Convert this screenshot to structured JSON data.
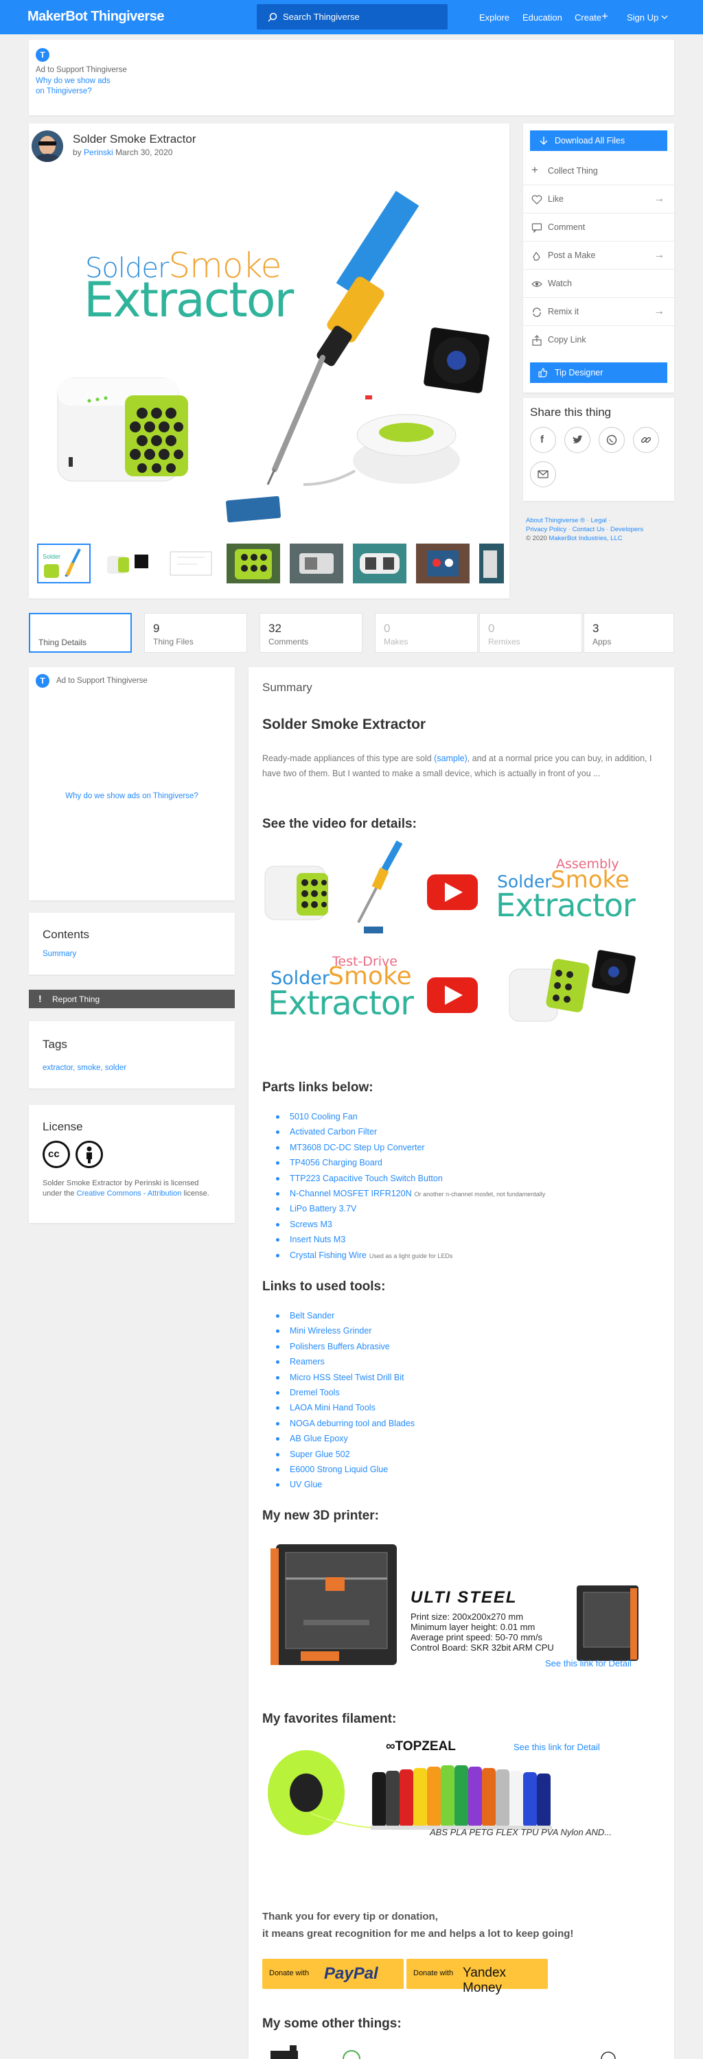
{
  "header": {
    "logo_brand": "MakerBot",
    "logo_product": "Thingiverse",
    "search_placeholder": "Search Thingiverse",
    "nav": [
      "Explore",
      "Education",
      "Create",
      "Sign Up"
    ]
  },
  "top_ad": {
    "badge": "T",
    "title": "Ad to Support Thingiverse",
    "why_line1": "Why do we show ads",
    "why_line2": "on Thingiverse?"
  },
  "thing": {
    "title": "Solder Smoke Extractor",
    "by": "by",
    "author": "Perinski",
    "date": "March 30, 2020",
    "hero_text_solder": "Solder",
    "hero_text_smoke": "Smoke",
    "hero_text_extractor": "Extractor",
    "thumbs": 8
  },
  "actions": {
    "download": "Download All Files",
    "items": [
      "Collect Thing",
      "Like",
      "Comment",
      "Post a Make",
      "Watch",
      "Remix it",
      "Copy Link"
    ],
    "tip": "Tip Designer"
  },
  "share": {
    "title": "Share this thing",
    "buttons": [
      "facebook",
      "twitter",
      "whatsapp",
      "link",
      "email"
    ]
  },
  "footer_links": {
    "about": "About Thingiverse ®",
    "legal": "Legal",
    "privacy": "Privacy Policy",
    "contact": "Contact Us",
    "developers": "Developers",
    "copyright_prefix": "© 2020",
    "copyright_link": "MakerBot Industries, LLC"
  },
  "tabs": [
    {
      "count": "",
      "label": "Thing Details"
    },
    {
      "count": "9",
      "label": "Thing Files"
    },
    {
      "count": "32",
      "label": "Comments"
    },
    {
      "count": "0",
      "label": "Makes"
    },
    {
      "count": "0",
      "label": "Remixes"
    },
    {
      "count": "3",
      "label": "Apps"
    }
  ],
  "left_ad": {
    "badge": "T",
    "title": "Ad to Support Thingiverse",
    "why": "Why do we show ads on Thingiverse?"
  },
  "contents": {
    "title": "Contents",
    "item": "Summary"
  },
  "report": {
    "label": "Report Thing"
  },
  "tags": {
    "title": "Tags",
    "list": "extractor, smoke, solder"
  },
  "license": {
    "title": "License",
    "text_pre": "Solder Smoke Extractor by Perinski is licensed under the",
    "link": "Creative Commons - Attribution",
    "text_post": "license."
  },
  "summary": {
    "label": "Summary",
    "heading": "Solder Smoke Extractor",
    "para_pre": "Ready-made appliances of this type are sold",
    "para_link": "(sample)",
    "para_post": ", and at a normal price you can buy, in addition, I have two of them. But I wanted to make a small device, which is actually in front of you ...",
    "video_heading": "See the video for details:",
    "video1_solder": "Solder",
    "video1_top": "Assembly",
    "video1_smoke": "Smoke",
    "video1_extractor": "Extractor",
    "video2_solder": "Solder",
    "video2_top": "Test-Drive",
    "video2_smoke": "Smoke",
    "video2_extractor": "Extractor",
    "parts_heading": "Parts links below:",
    "parts": [
      {
        "name": "5010 Cooling Fan",
        "note": ""
      },
      {
        "name": "Activated Carbon Filter",
        "note": ""
      },
      {
        "name": "MT3608 DC-DC Step Up Converter",
        "note": ""
      },
      {
        "name": "TP4056 Charging Board",
        "note": ""
      },
      {
        "name": "TTP223 Capacitive Touch Switch Button",
        "note": ""
      },
      {
        "name": "N-Channel MOSFET IRFR120N",
        "note": "Or another n-channel mosfet, not fundamentally"
      },
      {
        "name": "LiPo Battery 3.7V",
        "note": ""
      },
      {
        "name": "Screws M3",
        "note": ""
      },
      {
        "name": "Insert Nuts M3",
        "note": ""
      },
      {
        "name": "Crystal Fishing Wire",
        "note": "Used as a light guide for LEDs"
      }
    ],
    "tools_heading": "Links to used tools:",
    "tools": [
      "Belt Sander",
      "Mini Wireless Grinder",
      "Polishers Buffers Abrasive",
      "Reamers",
      "Micro HSS Steel Twist Drill Bit",
      "Dremel Tools",
      "LAOA Mini Hand Tools",
      "NOGA deburring tool and Blades",
      "AB Glue Epoxy",
      "Super Glue 502",
      "E6000 Strong Liquid Glue",
      "UV Glue"
    ],
    "printer_heading": "My new 3D printer:",
    "printer_brand": "ULTI STEEL",
    "printer_specs": [
      "Print size: 200x200x270 mm",
      "Minimum layer height: 0.01 mm",
      "Average print speed: 50-70 mm/s",
      "Control Board: SKR 32bit ARM CPU"
    ],
    "printer_link": "See this link for Detail",
    "filament_heading": "My favorites filament:",
    "filament_brand": "TOPZEAL",
    "filament_link": "See this link for Detail",
    "filament_types": "ABS PLA PETG FLEX TPU PVA Nylon AND...",
    "thanks_line1": "Thank you for every tip or donation,",
    "thanks_line2": "it means great recognition for me and helps a lot to keep going!",
    "donate_paypal_prefix": "Donate with",
    "donate_paypal_brand": "PayPal",
    "donate_yandex_prefix": "Donate with",
    "donate_yandex_brand": "Yandex Money",
    "other_heading": "My some other things:"
  },
  "colors": {
    "accent": "#248bfb",
    "header_search": "#0f62c9",
    "report_bg": "#555555",
    "donate_yellow": "#ffc439"
  }
}
